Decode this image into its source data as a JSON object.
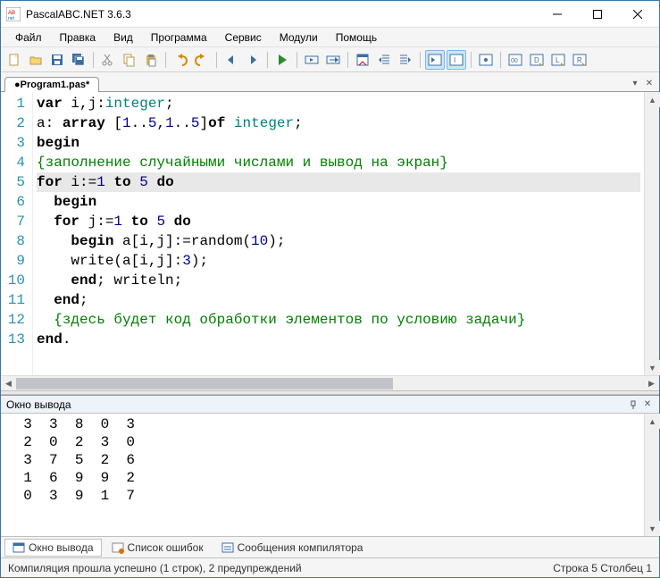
{
  "window": {
    "title": "PascalABC.NET 3.6.3"
  },
  "menu": [
    "Файл",
    "Правка",
    "Вид",
    "Программа",
    "Сервис",
    "Модули",
    "Помощь"
  ],
  "tab": {
    "label": "●Program1.pas*"
  },
  "gutter": [
    "1",
    "2",
    "3",
    "4",
    "5",
    "6",
    "7",
    "8",
    "9",
    "10",
    "11",
    "12",
    "13"
  ],
  "output": {
    "title": "Окно вывода",
    "text": "  3  3  8  0  3\n  2  0  2  3  0\n  3  7  5  2  6\n  1  6  9  9  2\n  0  3  9  1  7"
  },
  "bottom_tabs": {
    "output": "Окно вывода",
    "errors": "Список ошибок",
    "compiler": "Сообщения компилятора"
  },
  "status": {
    "left": "Компиляция прошла успешно (1 строк), 2 предупреждений",
    "right": "Строка  5  Столбец  1"
  },
  "code_tokens": [
    [
      [
        "kw",
        "var "
      ],
      [
        "",
        "i,j:"
      ],
      [
        "ty",
        "integer"
      ],
      [
        "",
        ";"
      ]
    ],
    [
      [
        "",
        "a: "
      ],
      [
        "kw",
        "array"
      ],
      [
        "",
        " ["
      ],
      [
        "nm",
        "1"
      ],
      [
        "",
        ".."
      ],
      [
        "nm",
        "5"
      ],
      [
        "",
        ","
      ],
      [
        "nm",
        "1"
      ],
      [
        "",
        ".."
      ],
      [
        "nm",
        "5"
      ],
      [
        "",
        "]"
      ],
      [
        "kw",
        "of "
      ],
      [
        "ty",
        "integer"
      ],
      [
        "",
        ";"
      ]
    ],
    [
      [
        "kw",
        "begin"
      ]
    ],
    [
      [
        "cm",
        "{заполнение случайными числами и вывод на экран}"
      ]
    ],
    [
      [
        "kw",
        "for"
      ],
      [
        "",
        " i:="
      ],
      [
        "nm",
        "1"
      ],
      [
        "",
        " "
      ],
      [
        "kw",
        "to"
      ],
      [
        "",
        " "
      ],
      [
        "nm",
        "5"
      ],
      [
        "",
        " "
      ],
      [
        "kw",
        "do"
      ]
    ],
    [
      [
        "",
        "  "
      ],
      [
        "kw",
        "begin"
      ]
    ],
    [
      [
        "",
        "  "
      ],
      [
        "kw",
        "for"
      ],
      [
        "",
        " j:="
      ],
      [
        "nm",
        "1"
      ],
      [
        "",
        " "
      ],
      [
        "kw",
        "to"
      ],
      [
        "",
        " "
      ],
      [
        "nm",
        "5"
      ],
      [
        "",
        " "
      ],
      [
        "kw",
        "do"
      ]
    ],
    [
      [
        "",
        "    "
      ],
      [
        "kw",
        "begin"
      ],
      [
        "",
        " a[i,j]:=random("
      ],
      [
        "nm",
        "10"
      ],
      [
        "",
        ");"
      ]
    ],
    [
      [
        "",
        "    write(a[i,j]:"
      ],
      [
        "nm",
        "3"
      ],
      [
        "",
        ");"
      ]
    ],
    [
      [
        "",
        "    "
      ],
      [
        "kw",
        "end"
      ],
      [
        "",
        "; writeln;"
      ]
    ],
    [
      [
        "",
        "  "
      ],
      [
        "kw",
        "end"
      ],
      [
        "",
        ";"
      ]
    ],
    [
      [
        "",
        "  "
      ],
      [
        "cm",
        "{здесь будет код обработки элементов по условию задачи}"
      ]
    ],
    [
      [
        "kw",
        "end"
      ],
      [
        "",
        "."
      ]
    ]
  ],
  "selected_line_index": 4
}
